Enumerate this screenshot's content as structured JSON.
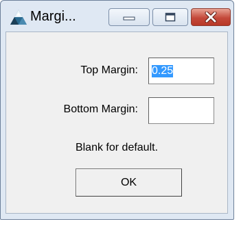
{
  "window": {
    "title": "Margi...",
    "icon": "triangle-app-icon",
    "caption_buttons": {
      "minimize_icon": "minimize-icon",
      "maximize_icon": "maximize-icon",
      "close_icon": "close-icon"
    }
  },
  "form": {
    "top_margin_label": "Top Margin:",
    "top_margin_value": "0.25",
    "bottom_margin_label": "Bottom Margin:",
    "bottom_margin_value": "",
    "hint": "Blank for default.",
    "ok_label": "OK"
  },
  "colors": {
    "frame": "#dfe8f3",
    "client": "#f0f0f0",
    "close_button": "#c4493a",
    "selection": "#3399ff"
  }
}
